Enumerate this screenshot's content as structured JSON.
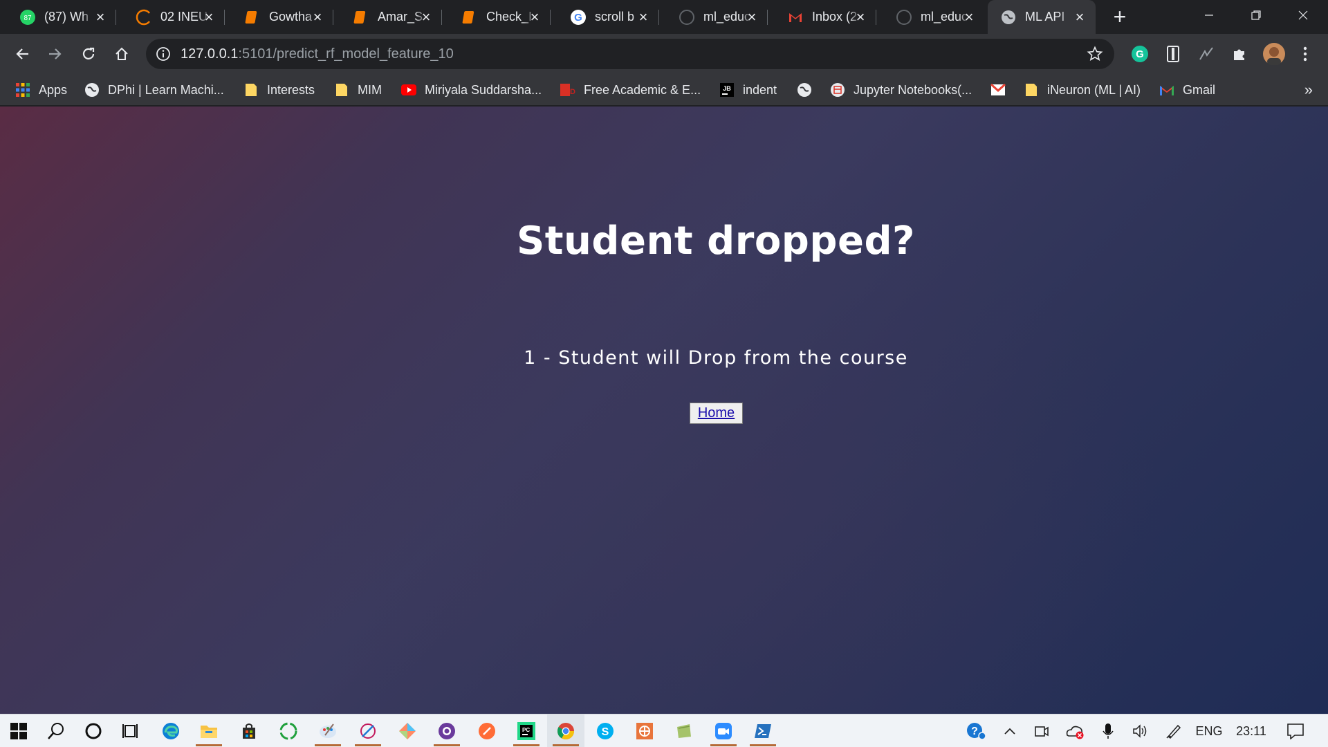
{
  "tabs": [
    {
      "title": "(87) Wh",
      "icon": "whatsapp-icon",
      "badge": "87"
    },
    {
      "title": "02 INEU",
      "icon": "loading-spinner-icon"
    },
    {
      "title": "Gowtha",
      "icon": "notebook-icon"
    },
    {
      "title": "Amar_S",
      "icon": "notebook-icon"
    },
    {
      "title": "Check_I",
      "icon": "notebook-icon"
    },
    {
      "title": "scroll b",
      "icon": "google-icon"
    },
    {
      "title": "ml_educ",
      "icon": "github-icon"
    },
    {
      "title": "Inbox (2",
      "icon": "gmail-icon"
    },
    {
      "title": "ml_educ",
      "icon": "github-icon"
    },
    {
      "title": "ML API",
      "icon": "globe-icon",
      "active": true
    }
  ],
  "toolbar": {
    "url_host": "127.0.0.1",
    "url_path": ":5101/predict_rf_model_feature_10"
  },
  "bookmarks": [
    {
      "label": "Apps",
      "icon": "apps-grid-icon"
    },
    {
      "label": "DPhi | Learn Machi...",
      "icon": "globe-icon"
    },
    {
      "label": "Interests",
      "icon": "folder-icon"
    },
    {
      "label": "MIM",
      "icon": "folder-icon"
    },
    {
      "label": "Miriyala Suddarsha...",
      "icon": "youtube-icon"
    },
    {
      "label": "Free Academic & E...",
      "icon": "pdf-icon"
    },
    {
      "label": "indent",
      "icon": "jetbrains-icon"
    },
    {
      "label": "",
      "icon": "globe-icon"
    },
    {
      "label": "Jupyter Notebooks(...",
      "icon": "jupyter-icon"
    },
    {
      "label": "",
      "icon": "gmail-icon"
    },
    {
      "label": "iNeuron (ML | AI)",
      "icon": "folder-icon"
    },
    {
      "label": "Gmail",
      "icon": "gmail-icon"
    }
  ],
  "bookmarks_more": "»",
  "page": {
    "heading": "Student dropped?",
    "result": "1 - Student will Drop from the course",
    "home_button": "Home"
  },
  "taskbar": {
    "language": "ENG",
    "clock": "23:11"
  },
  "colors": {
    "accent_taskbar_underline": "#b56a37",
    "link": "#1a0dab"
  }
}
